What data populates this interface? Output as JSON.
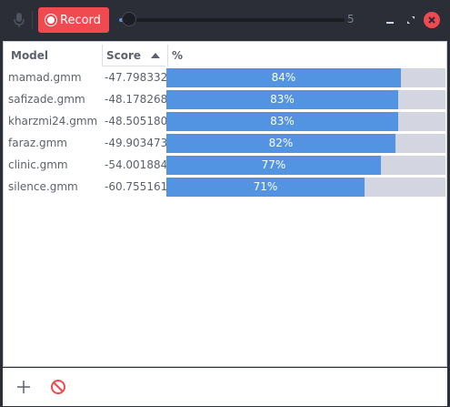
{
  "toolbar": {
    "record_label": "Record",
    "slider_max_label": "5",
    "slider_value": 0.05
  },
  "table": {
    "headers": {
      "model": "Model",
      "score": "Score",
      "percent": "%"
    },
    "rows": [
      {
        "model": "mamad.gmm",
        "score": "-47.798332",
        "percent": 84,
        "percent_label": "84%"
      },
      {
        "model": "safizade.gmm",
        "score": "-48.178268",
        "percent": 83,
        "percent_label": "83%"
      },
      {
        "model": "kharzmi24.gmm",
        "score": "-48.505180",
        "percent": 83,
        "percent_label": "83%"
      },
      {
        "model": "faraz.gmm",
        "score": "-49.903473",
        "percent": 82,
        "percent_label": "82%"
      },
      {
        "model": "clinic.gmm",
        "score": "-54.001884",
        "percent": 77,
        "percent_label": "77%"
      },
      {
        "model": "silence.gmm",
        "score": "-60.755161",
        "percent": 71,
        "percent_label": "71%"
      }
    ]
  },
  "colors": {
    "accent": "#5294e2",
    "record": "#f04a50",
    "close": "#f04a50"
  }
}
